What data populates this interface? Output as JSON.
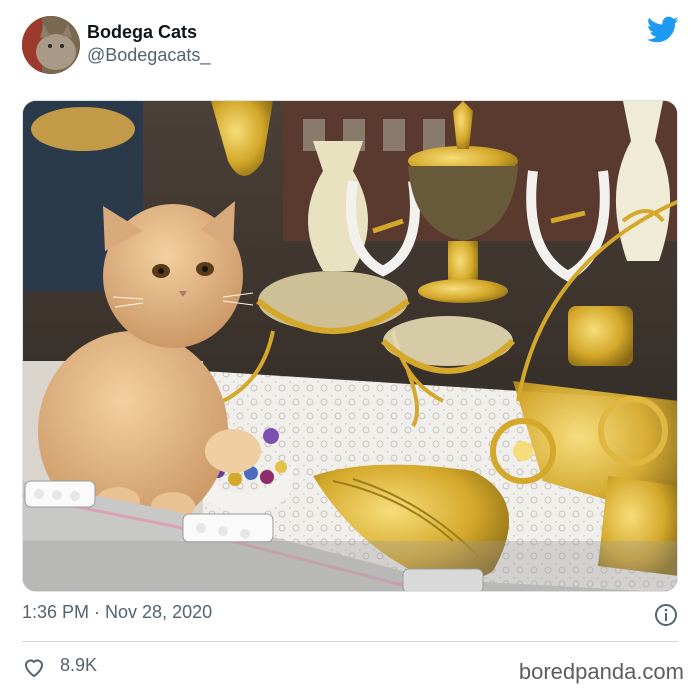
{
  "tweet": {
    "display_name": "Bodega Cats",
    "handle": "@Bodegacats_",
    "timestamp": "1:36 PM · Nov 28, 2020",
    "likes": "8.9K",
    "image_description": "Fluffy ginger cat sitting in a shop window display of gold decorative bowls, vases and trays",
    "icons": {
      "brand": "twitter-bird-icon",
      "info": "info-icon",
      "like": "heart-icon"
    }
  },
  "watermark": "boredpanda.com",
  "colors": {
    "twitter_blue": "#1d9bf0",
    "secondary_text": "#536471",
    "gold": "#d4a82a"
  }
}
